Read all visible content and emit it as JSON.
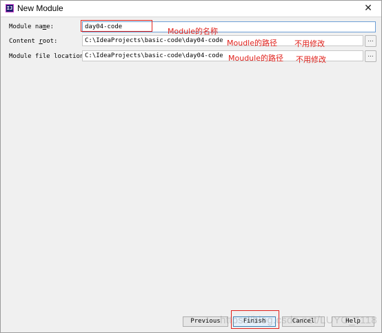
{
  "window": {
    "title": "New Module",
    "close_glyph": "✕"
  },
  "app_icon": {
    "icon": "intellij-idea-icon",
    "glyph": "IJ"
  },
  "form": {
    "module_name": {
      "label_pre": "Module na",
      "label_key": "m",
      "label_post": "e:",
      "value": "day04-code"
    },
    "content_root": {
      "label_pre": "Content ",
      "label_key": "r",
      "label_post": "oot:",
      "value": "C:\\IdeaProjects\\basic-code\\day04-code",
      "browse": "..."
    },
    "module_file_location": {
      "label": "Module file location:",
      "value": "C:\\IdeaProjects\\basic-code\\day04-code",
      "browse": "..."
    }
  },
  "annotations": {
    "module_name_note": "Module的名称",
    "content_root_note": "Moudle的路径",
    "content_root_note2": "不用修改",
    "file_location_note": "Moudule的路径",
    "file_location_note2": "不用修改",
    "color": "#e0201a"
  },
  "buttons": {
    "previous": "Previous",
    "finish": "Finish",
    "cancel": "Cancel",
    "help": "Help"
  },
  "watermark": "https://blog.csdn.net/LUYO_1118"
}
